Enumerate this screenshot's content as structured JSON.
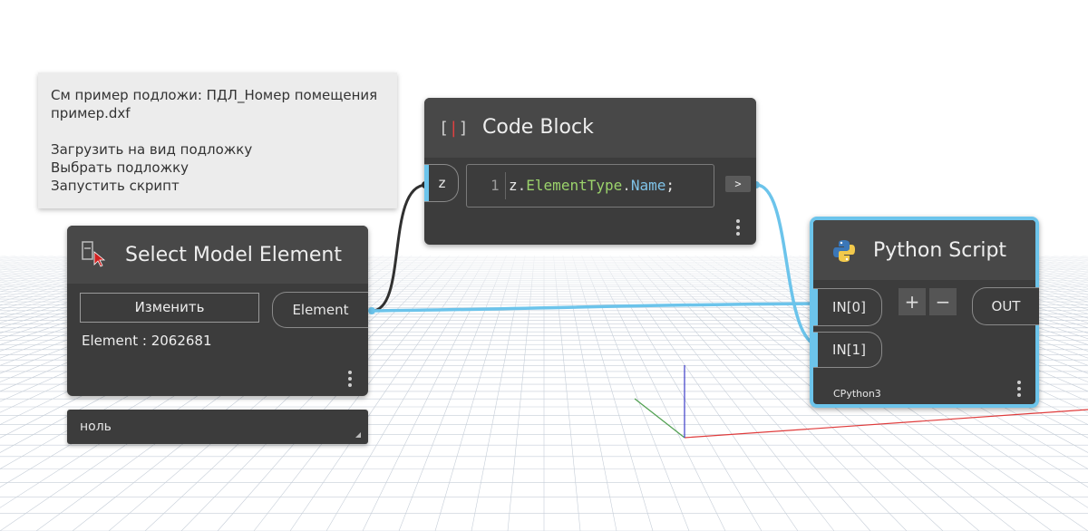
{
  "note": {
    "lines": [
      "См пример подложи: ПДЛ_Номер помещения",
      "пример.dxf",
      "",
      "Загрузить на вид подложку",
      "Выбрать подложку",
      "Запустить скрипт"
    ]
  },
  "select_node": {
    "title": "Select Model Element",
    "button_label": "Изменить",
    "output_port": "Element",
    "element_info": "Element : 2062681",
    "icon": "select-element-icon",
    "preview_value": "ноль"
  },
  "code_block": {
    "title": "Code Block",
    "input_port": "z",
    "line_number": "1",
    "code": {
      "obj": "z",
      "dot1": ".",
      "member1": "ElementType",
      "dot2": ".",
      "member2": "Name",
      "end": ";"
    },
    "output_port": ">",
    "icon": "code-block-icon"
  },
  "python_node": {
    "title": "Python Script",
    "input_ports": [
      "IN[0]",
      "IN[1]"
    ],
    "add_label": "+",
    "remove_label": "−",
    "output_port": "OUT",
    "engine": "CPython3",
    "icon": "python-icon"
  },
  "colors": {
    "wire_active": "#6cc4eb",
    "wire_default": "#303030",
    "node_bg": "#3c3c3c",
    "selected_border": "#6cc4eb",
    "axis_x": "#e03c3c",
    "axis_y": "#50a050",
    "axis_z": "#3c3cc8"
  }
}
